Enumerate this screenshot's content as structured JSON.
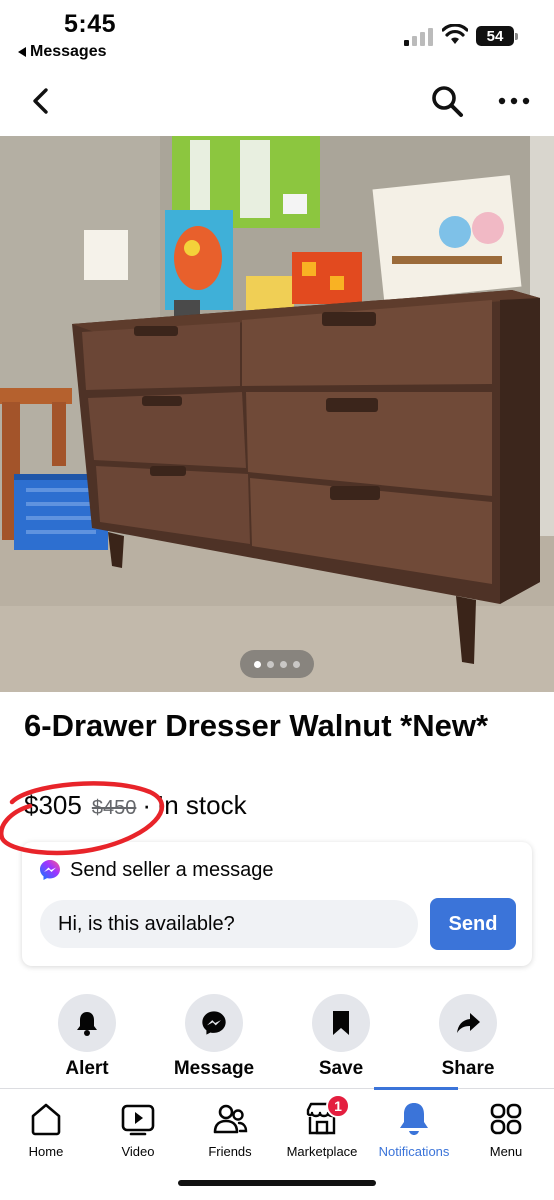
{
  "status_bar": {
    "time": "5:45",
    "back_app": "Messages",
    "battery": "54"
  },
  "nav": {
    "back_icon": "chevron-left-icon",
    "search_icon": "search-icon",
    "more_icon": "ellipsis-icon"
  },
  "listing": {
    "title": "6-Drawer Dresser Walnut *New*",
    "price": "$305",
    "original_price": "$450",
    "separator": "·",
    "availability": "In stock",
    "image_count": 4,
    "active_image_index": 0
  },
  "message_card": {
    "header": "Send seller a message",
    "input_value": "Hi, is this available?",
    "send_label": "Send"
  },
  "actions": [
    {
      "label": "Alert",
      "icon": "bell-icon"
    },
    {
      "label": "Message",
      "icon": "messenger-icon"
    },
    {
      "label": "Save",
      "icon": "bookmark-icon"
    },
    {
      "label": "Share",
      "icon": "share-icon"
    }
  ],
  "tabs": [
    {
      "label": "Home",
      "icon": "home-icon",
      "active": false
    },
    {
      "label": "Video",
      "icon": "video-icon",
      "active": false
    },
    {
      "label": "Friends",
      "icon": "friends-icon",
      "active": false
    },
    {
      "label": "Marketplace",
      "icon": "marketplace-icon",
      "active": false,
      "badge": "1"
    },
    {
      "label": "Notifications",
      "icon": "bell-icon",
      "active": true
    },
    {
      "label": "Menu",
      "icon": "menu-grid-icon",
      "active": false
    }
  ],
  "colors": {
    "accent": "#3b74d9",
    "badge": "#e41e3f",
    "annotation": "#e8242a"
  }
}
